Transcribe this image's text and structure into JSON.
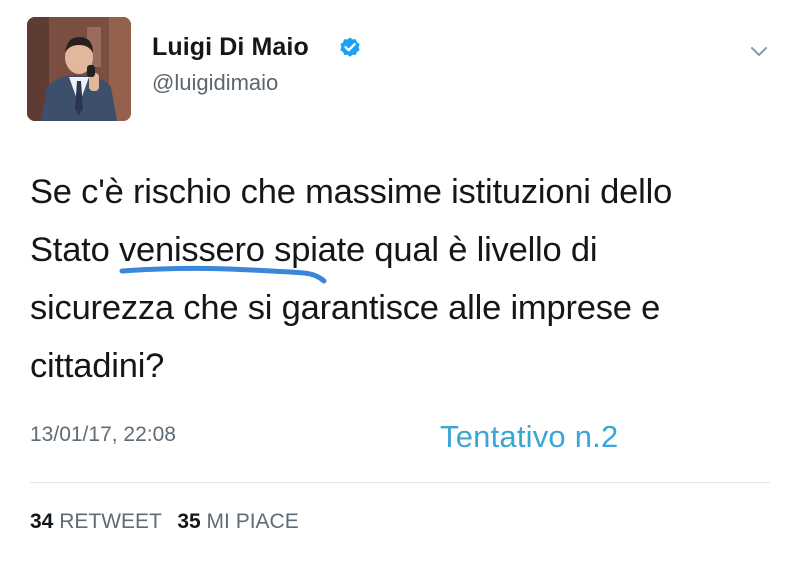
{
  "user": {
    "display_name": "Luigi Di Maio",
    "handle": "@luigidimaio",
    "verified": true
  },
  "tweet": {
    "lines": [
      "Se c'è rischio che massime istituzioni dello",
      "Stato venissero spiate qual è livello di",
      "sicurezza che si garantisce alle imprese e",
      "cittadini?"
    ],
    "timestamp": "13/01/17, 22:08"
  },
  "annotation": {
    "text": "Tentativo n.2",
    "color": "#3aa6d6"
  },
  "stats": {
    "retweets": {
      "count": "34",
      "label": "RETWEET"
    },
    "likes": {
      "count": "35",
      "label": "MI PIACE"
    }
  },
  "colors": {
    "verified": "#1da1f2",
    "underline": "#3a86d9"
  },
  "icons": {
    "verified": "verified-badge-icon",
    "menu": "chevron-down-icon"
  }
}
